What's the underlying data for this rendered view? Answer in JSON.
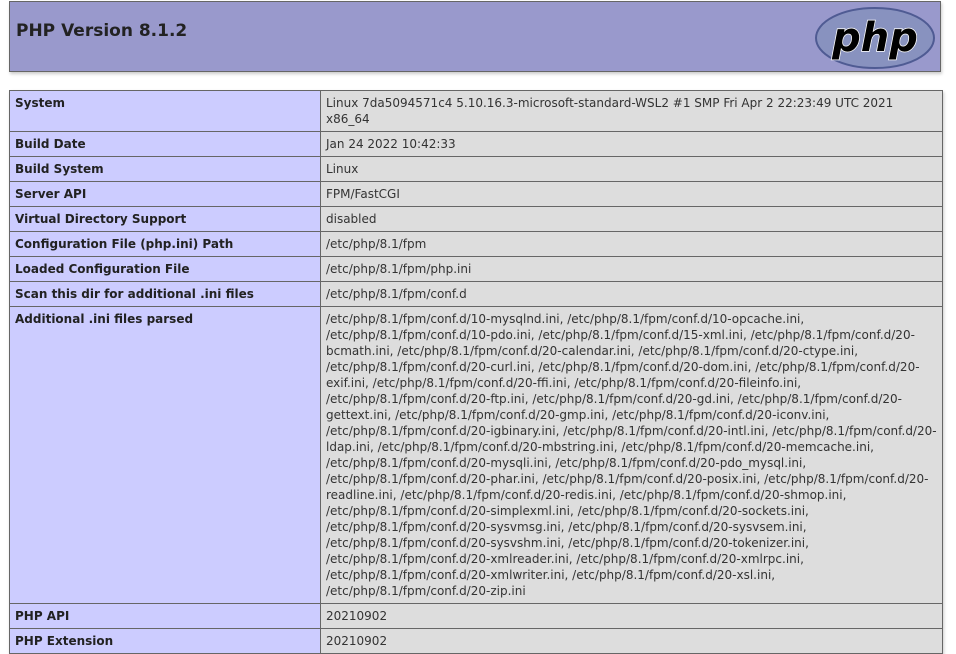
{
  "header": {
    "title": "PHP Version 8.1.2",
    "logo_text": "php"
  },
  "rows": [
    {
      "label": "System",
      "value": "Linux 7da5094571c4 5.10.16.3-microsoft-standard-WSL2 #1 SMP Fri Apr 2 22:23:49 UTC 2021 x86_64"
    },
    {
      "label": "Build Date",
      "value": "Jan 24 2022 10:42:33"
    },
    {
      "label": "Build System",
      "value": "Linux"
    },
    {
      "label": "Server API",
      "value": "FPM/FastCGI"
    },
    {
      "label": "Virtual Directory Support",
      "value": "disabled"
    },
    {
      "label": "Configuration File (php.ini) Path",
      "value": "/etc/php/8.1/fpm"
    },
    {
      "label": "Loaded Configuration File",
      "value": "/etc/php/8.1/fpm/php.ini"
    },
    {
      "label": "Scan this dir for additional .ini files",
      "value": "/etc/php/8.1/fpm/conf.d"
    },
    {
      "label": "Additional .ini files parsed",
      "value": "/etc/php/8.1/fpm/conf.d/10-mysqlnd.ini, /etc/php/8.1/fpm/conf.d/10-opcache.ini, /etc/php/8.1/fpm/conf.d/10-pdo.ini, /etc/php/8.1/fpm/conf.d/15-xml.ini, /etc/php/8.1/fpm/conf.d/20-bcmath.ini, /etc/php/8.1/fpm/conf.d/20-calendar.ini, /etc/php/8.1/fpm/conf.d/20-ctype.ini, /etc/php/8.1/fpm/conf.d/20-curl.ini, /etc/php/8.1/fpm/conf.d/20-dom.ini, /etc/php/8.1/fpm/conf.d/20-exif.ini, /etc/php/8.1/fpm/conf.d/20-ffi.ini, /etc/php/8.1/fpm/conf.d/20-fileinfo.ini, /etc/php/8.1/fpm/conf.d/20-ftp.ini, /etc/php/8.1/fpm/conf.d/20-gd.ini, /etc/php/8.1/fpm/conf.d/20-gettext.ini, /etc/php/8.1/fpm/conf.d/20-gmp.ini, /etc/php/8.1/fpm/conf.d/20-iconv.ini, /etc/php/8.1/fpm/conf.d/20-igbinary.ini, /etc/php/8.1/fpm/conf.d/20-intl.ini, /etc/php/8.1/fpm/conf.d/20-ldap.ini, /etc/php/8.1/fpm/conf.d/20-mbstring.ini, /etc/php/8.1/fpm/conf.d/20-memcache.ini, /etc/php/8.1/fpm/conf.d/20-mysqli.ini, /etc/php/8.1/fpm/conf.d/20-pdo_mysql.ini, /etc/php/8.1/fpm/conf.d/20-phar.ini, /etc/php/8.1/fpm/conf.d/20-posix.ini, /etc/php/8.1/fpm/conf.d/20-readline.ini, /etc/php/8.1/fpm/conf.d/20-redis.ini, /etc/php/8.1/fpm/conf.d/20-shmop.ini, /etc/php/8.1/fpm/conf.d/20-simplexml.ini, /etc/php/8.1/fpm/conf.d/20-sockets.ini, /etc/php/8.1/fpm/conf.d/20-sysvmsg.ini, /etc/php/8.1/fpm/conf.d/20-sysvsem.ini, /etc/php/8.1/fpm/conf.d/20-sysvshm.ini, /etc/php/8.1/fpm/conf.d/20-tokenizer.ini, /etc/php/8.1/fpm/conf.d/20-xmlreader.ini, /etc/php/8.1/fpm/conf.d/20-xmlrpc.ini, /etc/php/8.1/fpm/conf.d/20-xmlwriter.ini, /etc/php/8.1/fpm/conf.d/20-xsl.ini, /etc/php/8.1/fpm/conf.d/20-zip.ini"
    },
    {
      "label": "PHP API",
      "value": "20210902"
    },
    {
      "label": "PHP Extension",
      "value": "20210902"
    }
  ],
  "colors": {
    "header_bg": "#9999cc",
    "label_bg": "#ccccff",
    "value_bg": "#dddddd",
    "logo_bg": "#8892bf"
  }
}
